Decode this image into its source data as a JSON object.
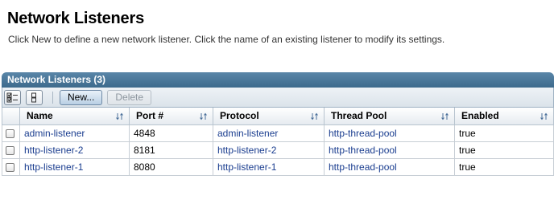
{
  "page": {
    "title": "Network Listeners",
    "help": "Click New to define a new network listener. Click the name of an existing listener to modify its settings."
  },
  "panel": {
    "title": "Network Listeners (3)",
    "toolbar": {
      "select_all_icon": "select-all-icon",
      "deselect_all_icon": "deselect-all-icon",
      "new_label": "New...",
      "delete_label": "Delete"
    }
  },
  "table": {
    "columns": [
      "Name",
      "Port #",
      "Protocol",
      "Thread Pool",
      "Enabled"
    ],
    "rows": [
      {
        "name": "admin-listener",
        "port": "4848",
        "protocol": "admin-listener",
        "thread_pool": "http-thread-pool",
        "enabled": "true"
      },
      {
        "name": "http-listener-2",
        "port": "8181",
        "protocol": "http-listener-2",
        "thread_pool": "http-thread-pool",
        "enabled": "true"
      },
      {
        "name": "http-listener-1",
        "port": "8080",
        "protocol": "http-listener-1",
        "thread_pool": "http-thread-pool",
        "enabled": "true"
      }
    ]
  },
  "colors": {
    "header_bar": "#3d6a8c",
    "link": "#1a3d8f"
  }
}
